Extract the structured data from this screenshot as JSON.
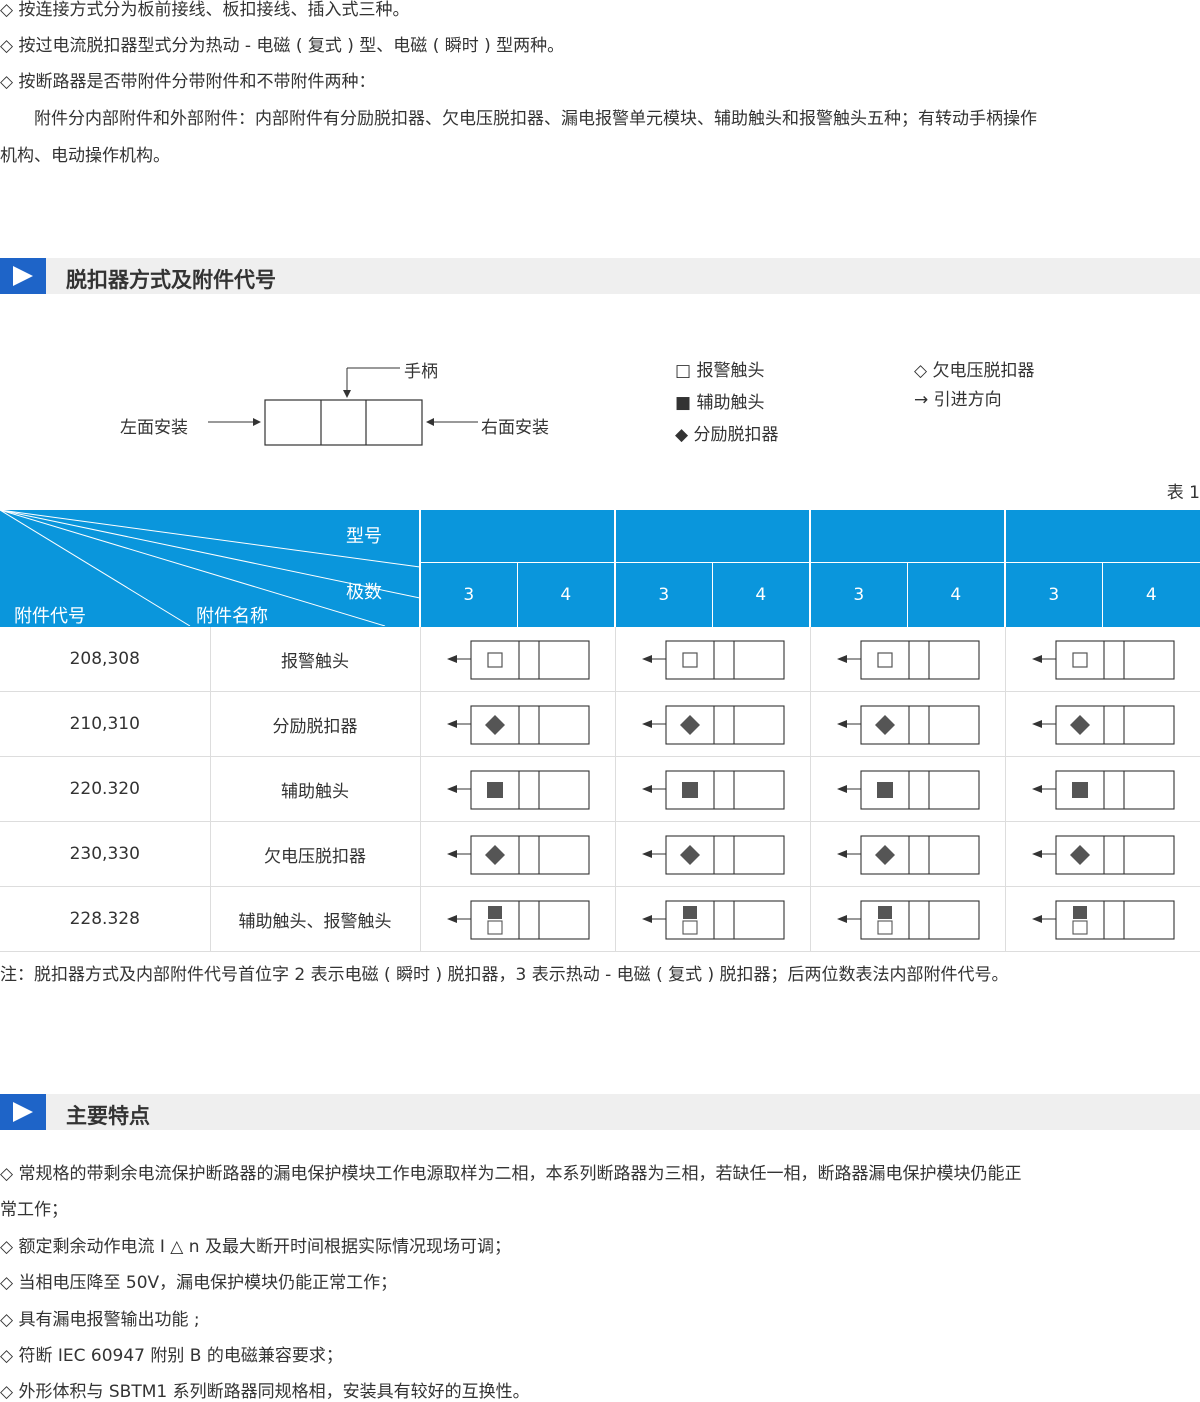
{
  "intro": {
    "lines": [
      "◇ 按连接方式分为板前接线、板扣接线、插入式三种。",
      "◇ 按过电流脱扣器型式分为热动 - 电磁 ( 复式 ) 型、电磁 ( 瞬时 ) 型两种。",
      "◇ 按断路器是否带附件分带附件和不带附件两种：",
      "　　附件分内部附件和外部附件：内部附件有分励脱扣器、欠电压脱扣器、漏电报警单元模块、辅助触头和报警触头五种；有转动手柄操作",
      "机构、电动操作机构。"
    ]
  },
  "section1": {
    "title": "脱扣器方式及附件代号"
  },
  "diagram": {
    "handle_label": "手柄",
    "left_label": "左面安装",
    "right_label": "右面安装"
  },
  "legend": {
    "alarm": "□ 报警触头",
    "aux": "■ 辅助触头",
    "shunt": "◆ 分励脱扣器",
    "undervoltage": "◇ 欠电压脱扣器",
    "lead": "→ 引进方向"
  },
  "table_caption": "表 1",
  "table": {
    "header_model": "型号",
    "header_poles": "极数",
    "header_code": "附件代号",
    "header_name": "附件名称",
    "pole_values": [
      "3",
      "4",
      "3",
      "4",
      "3",
      "4",
      "3",
      "4"
    ],
    "rows": [
      {
        "code": "208,308",
        "name": "报警触头",
        "symbol": "open-square"
      },
      {
        "code": "210,310",
        "name": "分励脱扣器",
        "symbol": "diamond"
      },
      {
        "code": "220.320",
        "name": "辅助触头",
        "symbol": "filled-square"
      },
      {
        "code": "230,330",
        "name": "欠电压脱扣器",
        "symbol": "diamond"
      },
      {
        "code": "228.328",
        "name": "辅助触头、报警触头",
        "symbol": "filled-over-open-square"
      }
    ]
  },
  "note": "注：脱扣器方式及内部附件代号首位字 2 表示电磁 ( 瞬时 ) 脱扣器，3 表示热动 - 电磁 ( 复式 ) 脱扣器；后两位数表法内部附件代号。",
  "section2": {
    "title": "主要特点"
  },
  "features": {
    "lines": [
      "◇ 常规格的带剩余电流保护断路器的漏电保护模块工作电源取样为二相，本系列断路器为三相，若缺任一相，断路器漏电保护模块仍能正",
      "常工作；",
      "◇ 额定剩余动作电流 I △ n 及最大断开时间根据实际情况现场可调；",
      "◇ 当相电压降至 50V，漏电保护模块仍能正常工作；",
      "◇ 具有漏电报警输出功能 ;",
      "◇ 符断 IEC 60947 附别 B 的电磁兼容要求；",
      "◇ 外形体积与 SBTM1 系列断路器同规格相，安装具有较好的互换性。"
    ]
  },
  "colors": {
    "header_blue": "#0a96dc",
    "accent_blue": "#1e64c8",
    "symbol_gray": "#555555"
  },
  "icons": [
    "play-triangle-icon",
    "arrow-left-icon",
    "arrow-down-icon",
    "open-square-icon",
    "filled-square-icon",
    "diamond-icon"
  ]
}
